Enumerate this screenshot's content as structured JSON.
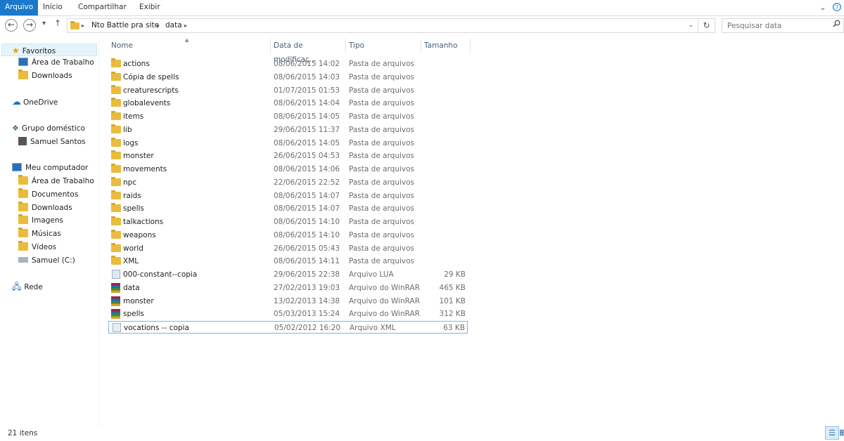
{
  "ribbon": {
    "tabs": [
      "Arquivo",
      "Início",
      "Compartilhar",
      "Exibir"
    ],
    "minimize_icon": "chevron-down-icon",
    "help_icon": "help-icon"
  },
  "address": {
    "crumbs": [
      "Nto Battle pra site",
      "data"
    ],
    "search_placeholder": "Pesquisar data"
  },
  "nav": {
    "favorites": "Favoritos",
    "fav_items": [
      "Área de Trabalho",
      "Downloads"
    ],
    "onedrive": "OneDrive",
    "homegroup": "Grupo doméstico",
    "homegroup_user": "Samuel Santos",
    "computer": "Meu computador",
    "computer_items": [
      "Área de Trabalho",
      "Documentos",
      "Downloads",
      "Imagens",
      "Músicas",
      "Vídeos",
      "Samuel (C:)"
    ],
    "network": "Rede"
  },
  "columns": {
    "name": "Nome",
    "date": "Data de modificaç...",
    "type": "Tipo",
    "size": "Tamanho"
  },
  "files": [
    {
      "name": "actions",
      "date": "08/06/2015 14:02",
      "type": "Pasta de arquivos",
      "size": "",
      "icon": "folder-icon"
    },
    {
      "name": "Cópia de spells",
      "date": "08/06/2015 14:03",
      "type": "Pasta de arquivos",
      "size": "",
      "icon": "folder-icon"
    },
    {
      "name": "creaturescripts",
      "date": "01/07/2015 01:53",
      "type": "Pasta de arquivos",
      "size": "",
      "icon": "folder-icon"
    },
    {
      "name": "globalevents",
      "date": "08/06/2015 14:04",
      "type": "Pasta de arquivos",
      "size": "",
      "icon": "folder-icon"
    },
    {
      "name": "items",
      "date": "08/06/2015 14:05",
      "type": "Pasta de arquivos",
      "size": "",
      "icon": "folder-icon"
    },
    {
      "name": "lib",
      "date": "29/06/2015 11:37",
      "type": "Pasta de arquivos",
      "size": "",
      "icon": "folder-icon"
    },
    {
      "name": "logs",
      "date": "08/06/2015 14:05",
      "type": "Pasta de arquivos",
      "size": "",
      "icon": "folder-icon"
    },
    {
      "name": "monster",
      "date": "26/06/2015 04:53",
      "type": "Pasta de arquivos",
      "size": "",
      "icon": "folder-icon"
    },
    {
      "name": "movements",
      "date": "08/06/2015 14:06",
      "type": "Pasta de arquivos",
      "size": "",
      "icon": "folder-icon"
    },
    {
      "name": "npc",
      "date": "22/06/2015 22:52",
      "type": "Pasta de arquivos",
      "size": "",
      "icon": "folder-icon"
    },
    {
      "name": "raids",
      "date": "08/06/2015 14:07",
      "type": "Pasta de arquivos",
      "size": "",
      "icon": "folder-icon"
    },
    {
      "name": "spells",
      "date": "08/06/2015 14:07",
      "type": "Pasta de arquivos",
      "size": "",
      "icon": "folder-icon"
    },
    {
      "name": "talkactions",
      "date": "08/06/2015 14:10",
      "type": "Pasta de arquivos",
      "size": "",
      "icon": "folder-icon"
    },
    {
      "name": "weapons",
      "date": "08/06/2015 14:10",
      "type": "Pasta de arquivos",
      "size": "",
      "icon": "folder-icon"
    },
    {
      "name": "world",
      "date": "26/06/2015 05:43",
      "type": "Pasta de arquivos",
      "size": "",
      "icon": "folder-icon"
    },
    {
      "name": "XML",
      "date": "08/06/2015 14:11",
      "type": "Pasta de arquivos",
      "size": "",
      "icon": "folder-icon"
    },
    {
      "name": "000-constant--copia",
      "date": "29/06/2015 22:38",
      "type": "Arquivo LUA",
      "size": "29 KB",
      "icon": "lua-file-icon"
    },
    {
      "name": "data",
      "date": "27/02/2013 19:03",
      "type": "Arquivo do WinRAR",
      "size": "465 KB",
      "icon": "winrar-archive-icon"
    },
    {
      "name": "monster",
      "date": "13/02/2013 14:38",
      "type": "Arquivo do WinRAR",
      "size": "101 KB",
      "icon": "winrar-archive-icon"
    },
    {
      "name": "spells",
      "date": "05/03/2013 15:24",
      "type": "Arquivo do WinRAR",
      "size": "312 KB",
      "icon": "winrar-archive-icon"
    },
    {
      "name": "vocations -- copia",
      "date": "05/02/2012 16:20",
      "type": "Arquivo XML",
      "size": "63 KB",
      "icon": "xml-file-icon"
    }
  ],
  "selected_file": "vocations -- copia",
  "status": {
    "count": "21 itens"
  },
  "colors": {
    "accent": "#1979ca",
    "folder": "#e9bc3d",
    "selection_border": "#7eb4ea"
  }
}
